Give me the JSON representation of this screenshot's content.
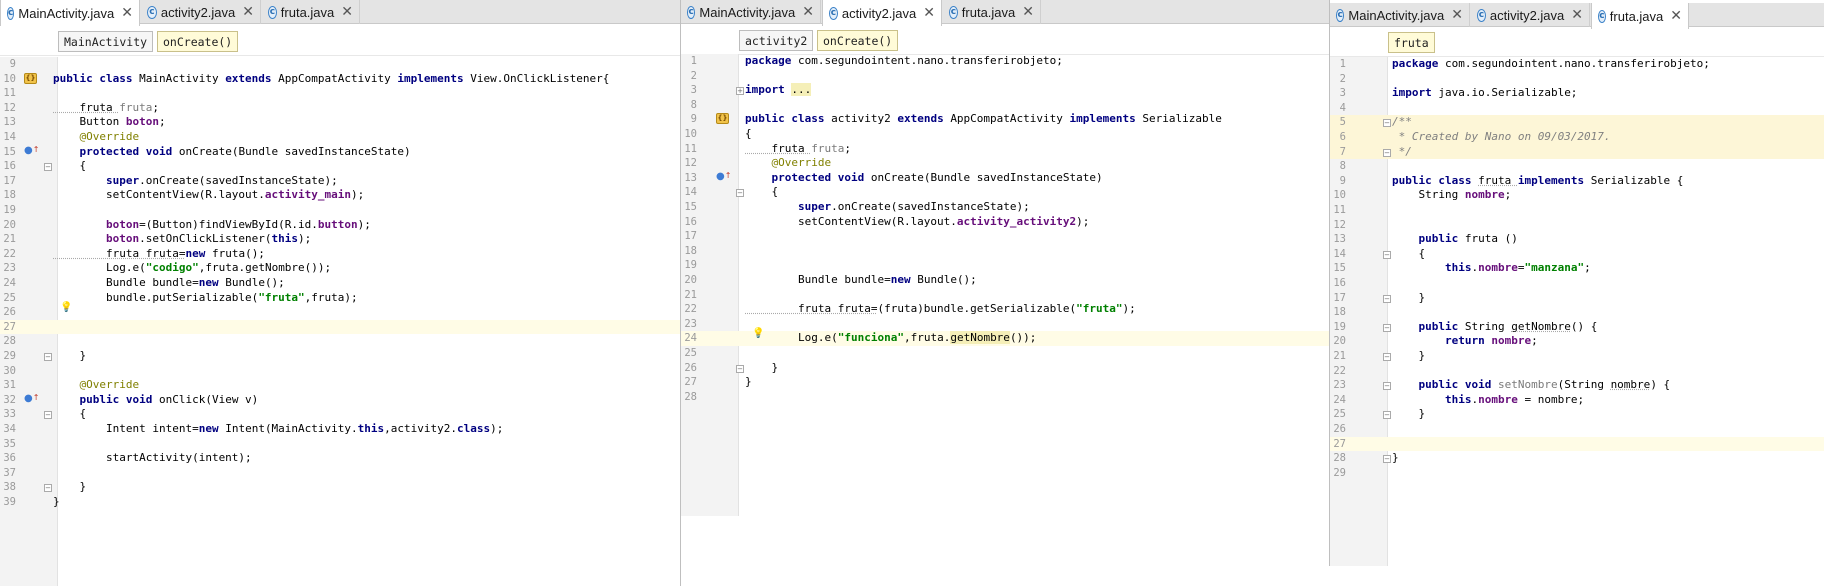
{
  "pane1": {
    "tabs": [
      "MainActivity.java",
      "activity2.java",
      "fruta.java"
    ],
    "crumbs": [
      "MainActivity",
      "onCreate()"
    ],
    "lines": [
      {
        "n": "9",
        "t": []
      },
      {
        "n": "10",
        "t": [
          [
            "public class ",
            "kw"
          ],
          [
            "MainActivity ",
            ""
          ],
          [
            "extends ",
            "kw"
          ],
          [
            "AppCompatActivity ",
            ""
          ],
          [
            "implements ",
            "kw"
          ],
          [
            "View.OnClickListener{",
            ""
          ]
        ],
        "g": "class"
      },
      {
        "n": "11",
        "t": []
      },
      {
        "n": "12",
        "t": [
          [
            "    fruta ",
            "under"
          ],
          [
            "fruta",
            "unused"
          ],
          [
            ";",
            ""
          ]
        ]
      },
      {
        "n": "13",
        "t": [
          [
            "    Button ",
            ""
          ],
          [
            "boton",
            "fld"
          ],
          [
            ";",
            ""
          ]
        ]
      },
      {
        "n": "14",
        "t": [
          [
            "    @Override",
            "ann"
          ]
        ]
      },
      {
        "n": "15",
        "t": [
          [
            "    protected void ",
            "kw"
          ],
          [
            "onCreate(Bundle savedInstanceState)",
            ""
          ]
        ],
        "g": "override"
      },
      {
        "n": "16",
        "t": [
          [
            "    {",
            ""
          ]
        ],
        "f": "open"
      },
      {
        "n": "17",
        "t": [
          [
            "        super",
            "kw"
          ],
          [
            ".onCreate(savedInstanceState);",
            ""
          ]
        ]
      },
      {
        "n": "18",
        "t": [
          [
            "        setContentView(R.layout.",
            ""
          ],
          [
            "activity_main",
            "fld"
          ],
          [
            ");",
            ""
          ]
        ]
      },
      {
        "n": "19",
        "t": []
      },
      {
        "n": "20",
        "t": [
          [
            "        boton",
            "fld"
          ],
          [
            "=(Button)findViewById(R.id.",
            ""
          ],
          [
            "button",
            "fld"
          ],
          [
            ");",
            ""
          ]
        ]
      },
      {
        "n": "21",
        "t": [
          [
            "        boton",
            "fld"
          ],
          [
            ".setOnClickListener(",
            ""
          ],
          [
            "this",
            "kw"
          ],
          [
            ");",
            ""
          ]
        ]
      },
      {
        "n": "22",
        "t": [
          [
            "        fruta fruta=",
            "under"
          ],
          [
            "new ",
            "kw"
          ],
          [
            "fruta();",
            ""
          ]
        ]
      },
      {
        "n": "23",
        "t": [
          [
            "        Log.",
            ""
          ],
          [
            "e",
            "meth"
          ],
          [
            "(",
            ""
          ],
          [
            "\"codigo\"",
            "str"
          ],
          [
            ",fruta.getNombre());",
            ""
          ]
        ]
      },
      {
        "n": "24",
        "t": [
          [
            "        Bundle bundle=",
            ""
          ],
          [
            "new ",
            "kw"
          ],
          [
            "Bundle();",
            ""
          ]
        ]
      },
      {
        "n": "25",
        "t": [
          [
            "        bundle.putSerializable(",
            ""
          ],
          [
            "\"fruta\"",
            "str"
          ],
          [
            ",fruta);",
            ""
          ]
        ]
      },
      {
        "n": "26",
        "t": [],
        "g": "bulb"
      },
      {
        "n": "27",
        "t": [],
        "hl": "cur"
      },
      {
        "n": "28",
        "t": []
      },
      {
        "n": "29",
        "t": [
          [
            "    }",
            ""
          ]
        ],
        "f": "close"
      },
      {
        "n": "30",
        "t": []
      },
      {
        "n": "31",
        "t": [
          [
            "    @Override",
            "ann"
          ]
        ]
      },
      {
        "n": "32",
        "t": [
          [
            "    public void ",
            "kw"
          ],
          [
            "onClick(View v)",
            ""
          ]
        ],
        "g": "override"
      },
      {
        "n": "33",
        "t": [
          [
            "    {",
            ""
          ]
        ],
        "f": "open"
      },
      {
        "n": "34",
        "t": [
          [
            "        Intent intent=",
            ""
          ],
          [
            "new ",
            "kw"
          ],
          [
            "Intent(MainActivity.",
            ""
          ],
          [
            "this",
            "kw"
          ],
          [
            ",activity2.",
            ""
          ],
          [
            "class",
            "kw"
          ],
          [
            ");",
            ""
          ]
        ]
      },
      {
        "n": "35",
        "t": []
      },
      {
        "n": "36",
        "t": [
          [
            "        startActivity(intent);",
            ""
          ]
        ]
      },
      {
        "n": "37",
        "t": []
      },
      {
        "n": "38",
        "t": [
          [
            "    }",
            ""
          ]
        ],
        "f": "close"
      },
      {
        "n": "39",
        "t": [
          [
            "}",
            ""
          ]
        ]
      }
    ]
  },
  "pane2": {
    "tabs": [
      "MainActivity.java",
      "activity2.java",
      "fruta.java"
    ],
    "crumbs": [
      "activity2",
      "onCreate()"
    ],
    "lines": [
      {
        "n": "1",
        "t": [
          [
            "package ",
            "kw"
          ],
          [
            "com.segundointent.nano.transferirobjeto;",
            ""
          ]
        ]
      },
      {
        "n": "2",
        "t": []
      },
      {
        "n": "3",
        "t": [
          [
            "import ",
            "kw"
          ],
          [
            "...",
            "match"
          ]
        ],
        "f": "plus"
      },
      {
        "n": "8",
        "t": []
      },
      {
        "n": "9",
        "t": [
          [
            "public class ",
            "kw"
          ],
          [
            "activity2 ",
            ""
          ],
          [
            "extends ",
            "kw"
          ],
          [
            "AppCompatActivity ",
            ""
          ],
          [
            "implements ",
            "kw"
          ],
          [
            "Serializable",
            ""
          ]
        ],
        "g": "class"
      },
      {
        "n": "10",
        "t": [
          [
            "{",
            ""
          ]
        ]
      },
      {
        "n": "11",
        "t": [
          [
            "    fruta ",
            "under"
          ],
          [
            "fruta",
            "unused"
          ],
          [
            ";",
            ""
          ]
        ]
      },
      {
        "n": "12",
        "t": [
          [
            "    @Override",
            "ann"
          ]
        ]
      },
      {
        "n": "13",
        "t": [
          [
            "    protected void ",
            "kw"
          ],
          [
            "onCreate(Bundle savedInstanceState)",
            ""
          ]
        ],
        "g": "override"
      },
      {
        "n": "14",
        "t": [
          [
            "    {",
            ""
          ]
        ],
        "f": "open"
      },
      {
        "n": "15",
        "t": [
          [
            "        super",
            "kw"
          ],
          [
            ".onCreate(savedInstanceState);",
            ""
          ]
        ]
      },
      {
        "n": "16",
        "t": [
          [
            "        setContentView(R.layout.",
            ""
          ],
          [
            "activity_activity2",
            "fld"
          ],
          [
            ");",
            ""
          ]
        ]
      },
      {
        "n": "17",
        "t": []
      },
      {
        "n": "18",
        "t": []
      },
      {
        "n": "19",
        "t": []
      },
      {
        "n": "20",
        "t": [
          [
            "        Bundle bundle=",
            ""
          ],
          [
            "new ",
            "kw"
          ],
          [
            "Bundle();",
            ""
          ]
        ]
      },
      {
        "n": "21",
        "t": []
      },
      {
        "n": "22",
        "t": [
          [
            "        fruta fruta=",
            "under"
          ],
          [
            "(fruta)bundle.getSerializable(",
            ""
          ],
          [
            "\"fruta\"",
            "str"
          ],
          [
            ");",
            ""
          ]
        ]
      },
      {
        "n": "23",
        "t": []
      },
      {
        "n": "24",
        "t": [
          [
            "        Log.",
            ""
          ],
          [
            "e",
            "meth"
          ],
          [
            "(",
            ""
          ],
          [
            "\"funciona\"",
            "str"
          ],
          [
            ",fruta.",
            ""
          ],
          [
            "getNombre",
            "match"
          ],
          [
            "());",
            ""
          ]
        ],
        "g": "bulb",
        "hl": "cur"
      },
      {
        "n": "25",
        "t": []
      },
      {
        "n": "26",
        "t": [
          [
            "    }",
            ""
          ]
        ],
        "f": "close"
      },
      {
        "n": "27",
        "t": [
          [
            "}",
            ""
          ]
        ]
      },
      {
        "n": "28",
        "t": []
      }
    ]
  },
  "pane3": {
    "tabs": [
      "MainActivity.java",
      "activity2.java",
      "fruta.java"
    ],
    "crumbs": [
      "fruta"
    ],
    "lines": [
      {
        "n": "1",
        "t": [
          [
            "package ",
            "kw"
          ],
          [
            "com.segundointent.nano.transferirobjeto;",
            ""
          ]
        ]
      },
      {
        "n": "2",
        "t": []
      },
      {
        "n": "3",
        "t": [
          [
            "import ",
            "kw"
          ],
          [
            "java.io.Serializable;",
            ""
          ]
        ]
      },
      {
        "n": "4",
        "t": []
      },
      {
        "n": "5",
        "t": [
          [
            "/**",
            "doc"
          ]
        ],
        "hl": "doc",
        "f": "open"
      },
      {
        "n": "6",
        "t": [
          [
            " * Created by Nano on 09/03/2017.",
            "doc"
          ]
        ],
        "hl": "doc"
      },
      {
        "n": "7",
        "t": [
          [
            " */",
            "doc"
          ]
        ],
        "hl": "doc",
        "f": "close"
      },
      {
        "n": "8",
        "t": []
      },
      {
        "n": "9",
        "t": [
          [
            "public class ",
            "kw"
          ],
          [
            "fruta ",
            "under"
          ],
          [
            "implements ",
            "kw"
          ],
          [
            "Serializable {",
            ""
          ]
        ]
      },
      {
        "n": "10",
        "t": [
          [
            "    String ",
            ""
          ],
          [
            "nombre",
            "fld"
          ],
          [
            ";",
            ""
          ]
        ]
      },
      {
        "n": "11",
        "t": []
      },
      {
        "n": "12",
        "t": []
      },
      {
        "n": "13",
        "t": [
          [
            "    public ",
            "kw"
          ],
          [
            "fruta ()",
            ""
          ]
        ]
      },
      {
        "n": "14",
        "t": [
          [
            "    {",
            ""
          ]
        ],
        "f": "open"
      },
      {
        "n": "15",
        "t": [
          [
            "        this",
            "kw"
          ],
          [
            ".",
            ""
          ],
          [
            "nombre",
            "fld"
          ],
          [
            "=",
            ""
          ],
          [
            "\"manzana\"",
            "str"
          ],
          [
            ";",
            ""
          ]
        ]
      },
      {
        "n": "16",
        "t": []
      },
      {
        "n": "17",
        "t": [
          [
            "    }",
            ""
          ]
        ],
        "f": "close"
      },
      {
        "n": "18",
        "t": []
      },
      {
        "n": "19",
        "t": [
          [
            "    public ",
            "kw"
          ],
          [
            "String ",
            ""
          ],
          [
            "getNombre",
            "under"
          ],
          [
            "() {",
            ""
          ]
        ],
        "f": "open"
      },
      {
        "n": "20",
        "t": [
          [
            "        return ",
            "kw"
          ],
          [
            "nombre",
            "fld"
          ],
          [
            ";",
            ""
          ]
        ]
      },
      {
        "n": "21",
        "t": [
          [
            "    }",
            ""
          ]
        ],
        "f": "close"
      },
      {
        "n": "22",
        "t": []
      },
      {
        "n": "23",
        "t": [
          [
            "    public void ",
            "kw"
          ],
          [
            "setNombre",
            "unused"
          ],
          [
            "(String ",
            ""
          ],
          [
            "nombre",
            "under"
          ],
          [
            ") {",
            ""
          ]
        ],
        "f": "open"
      },
      {
        "n": "24",
        "t": [
          [
            "        this",
            "kw"
          ],
          [
            ".",
            ""
          ],
          [
            "nombre",
            "fld"
          ],
          [
            " = nombre;",
            ""
          ]
        ]
      },
      {
        "n": "25",
        "t": [
          [
            "    }",
            ""
          ]
        ],
        "f": "close"
      },
      {
        "n": "26",
        "t": []
      },
      {
        "n": "27",
        "t": [],
        "hl": "cur"
      },
      {
        "n": "28",
        "t": [
          [
            "}",
            ""
          ]
        ],
        "f": "close"
      },
      {
        "n": "29",
        "t": []
      }
    ]
  }
}
